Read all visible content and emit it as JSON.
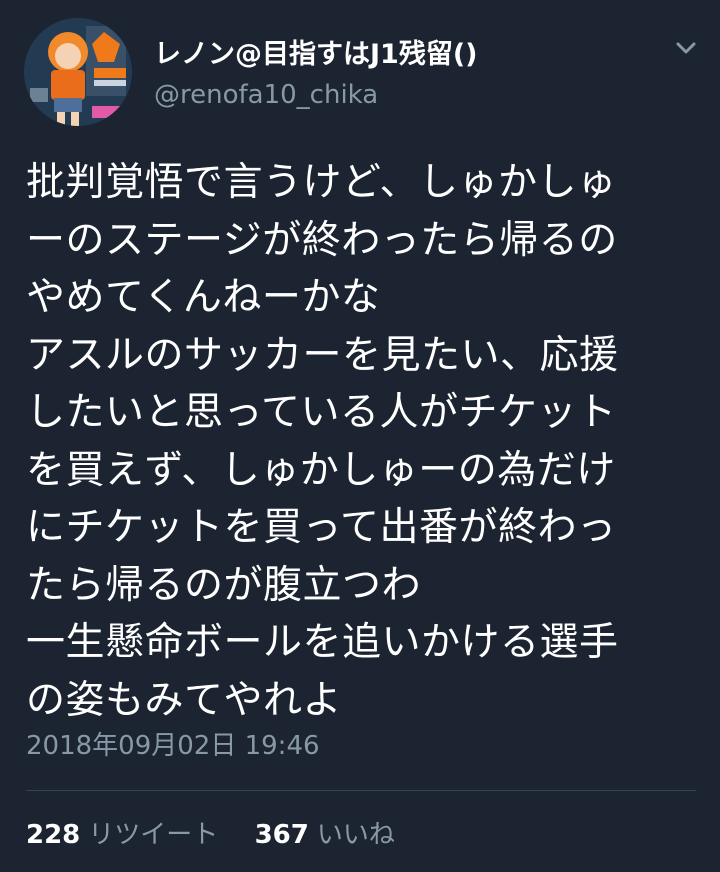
{
  "user": {
    "display_name": "レノン@目指すはJ1残留()",
    "handle": "@renofa10_chika"
  },
  "tweet": {
    "lines": [
      "批判覚悟で言うけど、しゅかしゅ",
      "ーのステージが終わったら帰るの",
      "やめてくんねーかな",
      "アスルのサッカーを見たい、応援",
      "したいと思っている人がチケット",
      "を買えず、しゅかしゅーの為だけ",
      "にチケットを買って出番が終わっ",
      "たら帰るのが腹立つわ",
      "一生懸命ボールを追いかける選手",
      "の姿もみてやれよ"
    ],
    "timestamp": "2018年09月02日 19:46"
  },
  "stats": {
    "retweets_count": "228",
    "retweets_label": "リツイート",
    "likes_count": "367",
    "likes_label": "いいね"
  },
  "icons": {
    "menu": "chevron-down-icon",
    "avatar": "avatar-image"
  },
  "colors": {
    "background": "#1b2430",
    "text": "#ffffff",
    "secondary": "#8899a6",
    "divider": "#38444d"
  }
}
